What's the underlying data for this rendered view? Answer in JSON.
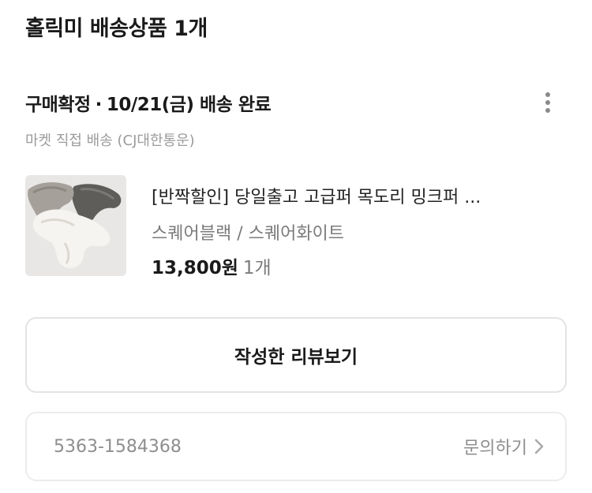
{
  "seller": {
    "title": "홀릭미 배송상품 1개"
  },
  "order": {
    "status": "구매확정",
    "separator": "·",
    "date": "10/21(금)",
    "delivery_status": "배송 완료",
    "delivery_info": "마켓 직접 배송 (CJ대한통운)"
  },
  "product": {
    "name": "[반짝할인] 당일출고 고급퍼 목도리 밍크퍼 ...",
    "option": "스퀘어블랙 / 스퀘어화이트",
    "price": "13,800원",
    "quantity": "1개",
    "image_icon": "fur-scarf-photo"
  },
  "actions": {
    "review_button": "작성한 리뷰보기"
  },
  "order_card": {
    "number": "5363-1584368",
    "inquiry_label": "문의하기"
  },
  "colors": {
    "accent_text": "#1a1a1a",
    "muted_text": "#8e8e8e",
    "border": "#e3e3e3"
  }
}
